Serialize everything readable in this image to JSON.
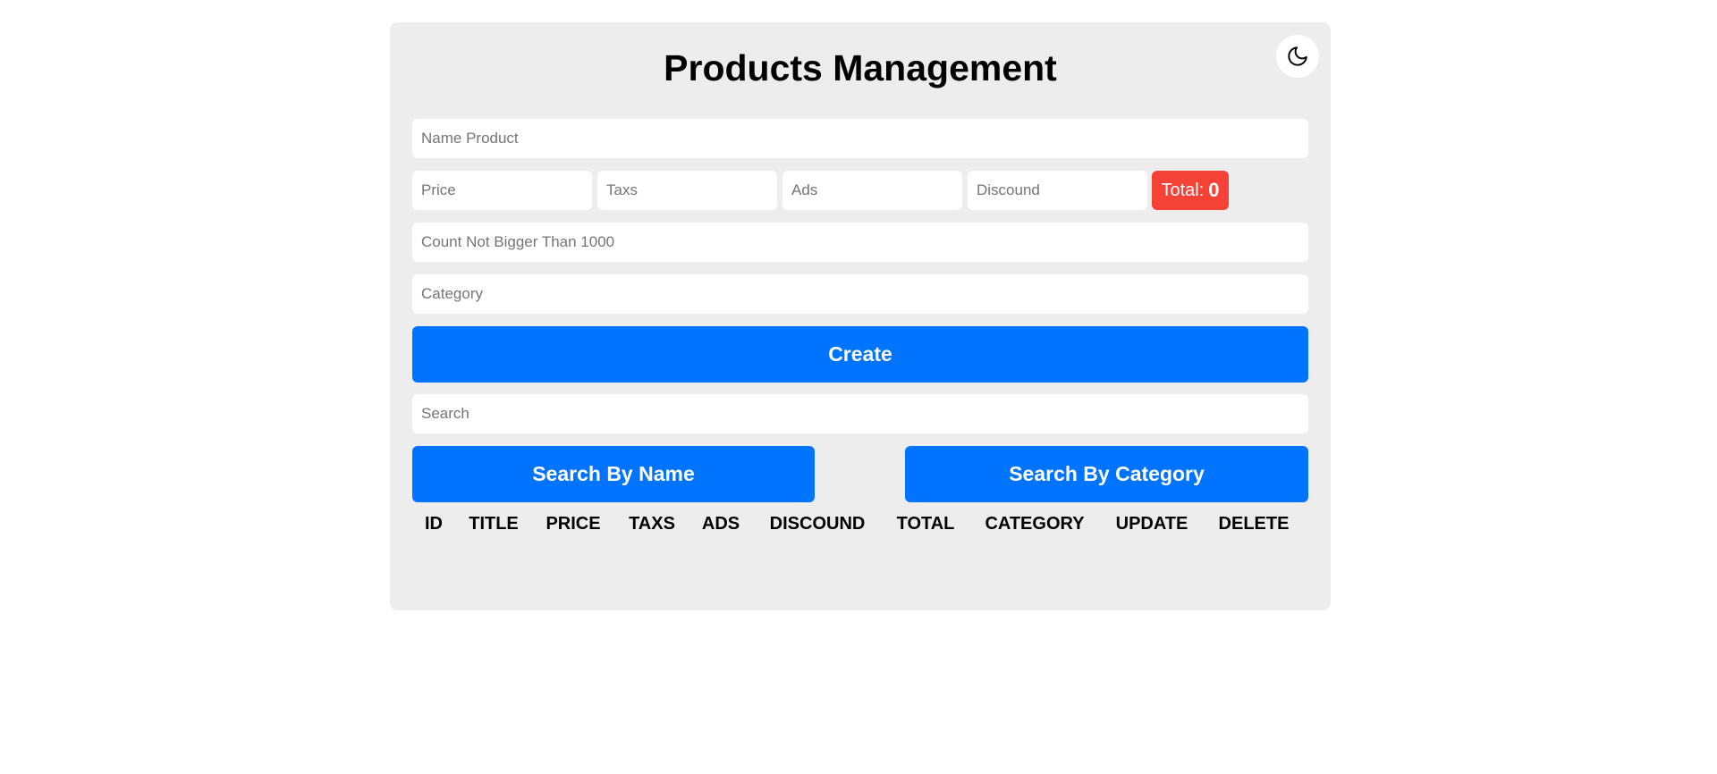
{
  "title": "Products Management",
  "theme_toggle": {
    "icon": "moon-icon"
  },
  "form": {
    "name_placeholder": "Name Product",
    "price_placeholder": "Price",
    "taxs_placeholder": "Taxs",
    "ads_placeholder": "Ads",
    "discount_placeholder": "Discound",
    "total_label": "Total:",
    "total_value": "0",
    "count_placeholder": "Count Not Bigger Than 1000",
    "category_placeholder": "Category",
    "create_label": "Create"
  },
  "search": {
    "placeholder": "Search",
    "by_name_label": "Search By Name",
    "by_category_label": "Search By Category"
  },
  "table": {
    "columns": [
      "ID",
      "TITLE",
      "PRICE",
      "TAXS",
      "ADS",
      "DISCOUND",
      "TOTAL",
      "CATEGORY",
      "UPDATE",
      "DELETE"
    ]
  },
  "colors": {
    "panel_bg": "#ededed",
    "accent": "#0073ff",
    "total_bg": "#f44336"
  }
}
